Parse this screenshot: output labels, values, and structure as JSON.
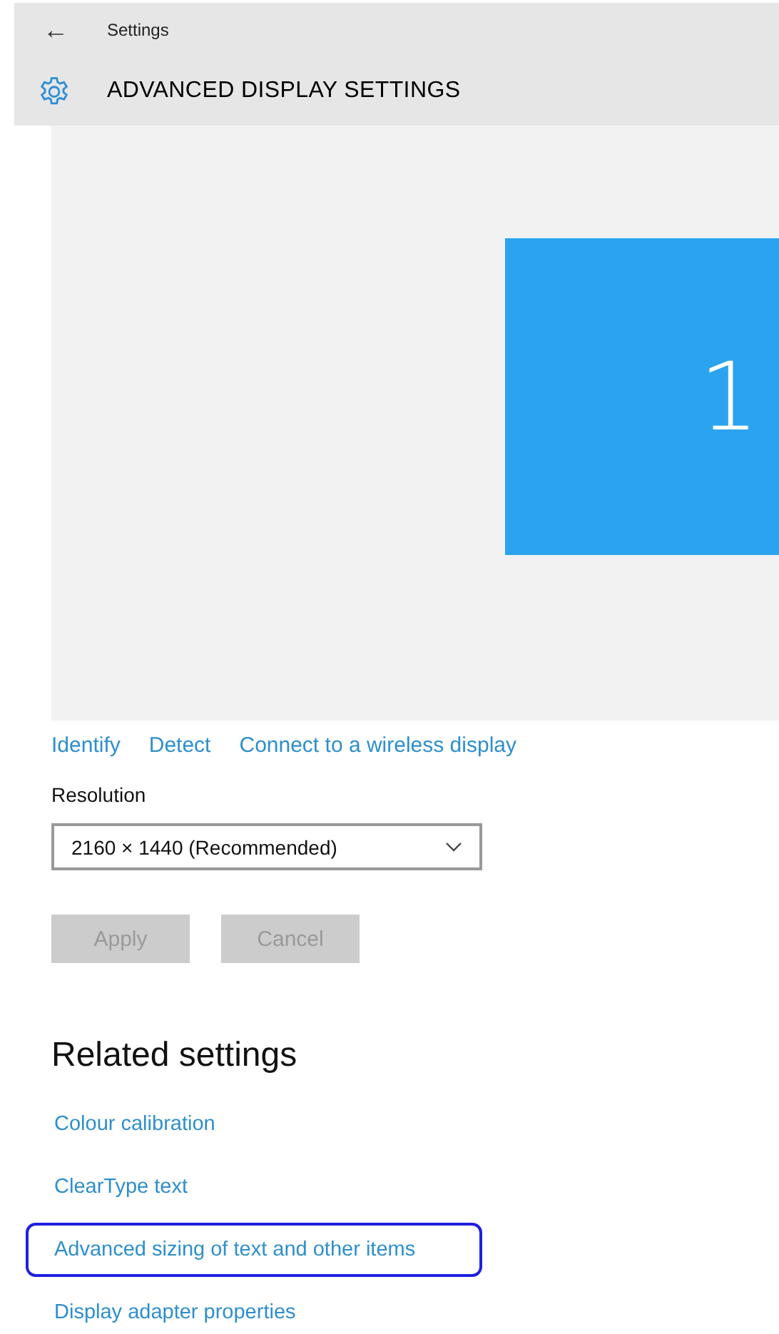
{
  "header": {
    "back_glyph": "←",
    "app_title": "Settings",
    "page_title": "ADVANCED DISPLAY SETTINGS"
  },
  "display_preview": {
    "monitors": [
      {
        "label": "1",
        "selected": true
      }
    ]
  },
  "display_links": [
    "Identify",
    "Detect",
    "Connect to a wireless display"
  ],
  "resolution": {
    "label": "Resolution",
    "value": "2160 × 1440 (Recommended)"
  },
  "buttons": [
    {
      "label": "Apply",
      "disabled": true
    },
    {
      "label": "Cancel",
      "disabled": true
    }
  ],
  "related_settings": {
    "heading": "Related settings",
    "links": [
      {
        "label": "Colour calibration",
        "focused": false
      },
      {
        "label": "ClearType text",
        "focused": false
      },
      {
        "label": "Advanced sizing of text and other items",
        "focused": true
      },
      {
        "label": "Display adapter properties",
        "focused": false
      }
    ]
  }
}
